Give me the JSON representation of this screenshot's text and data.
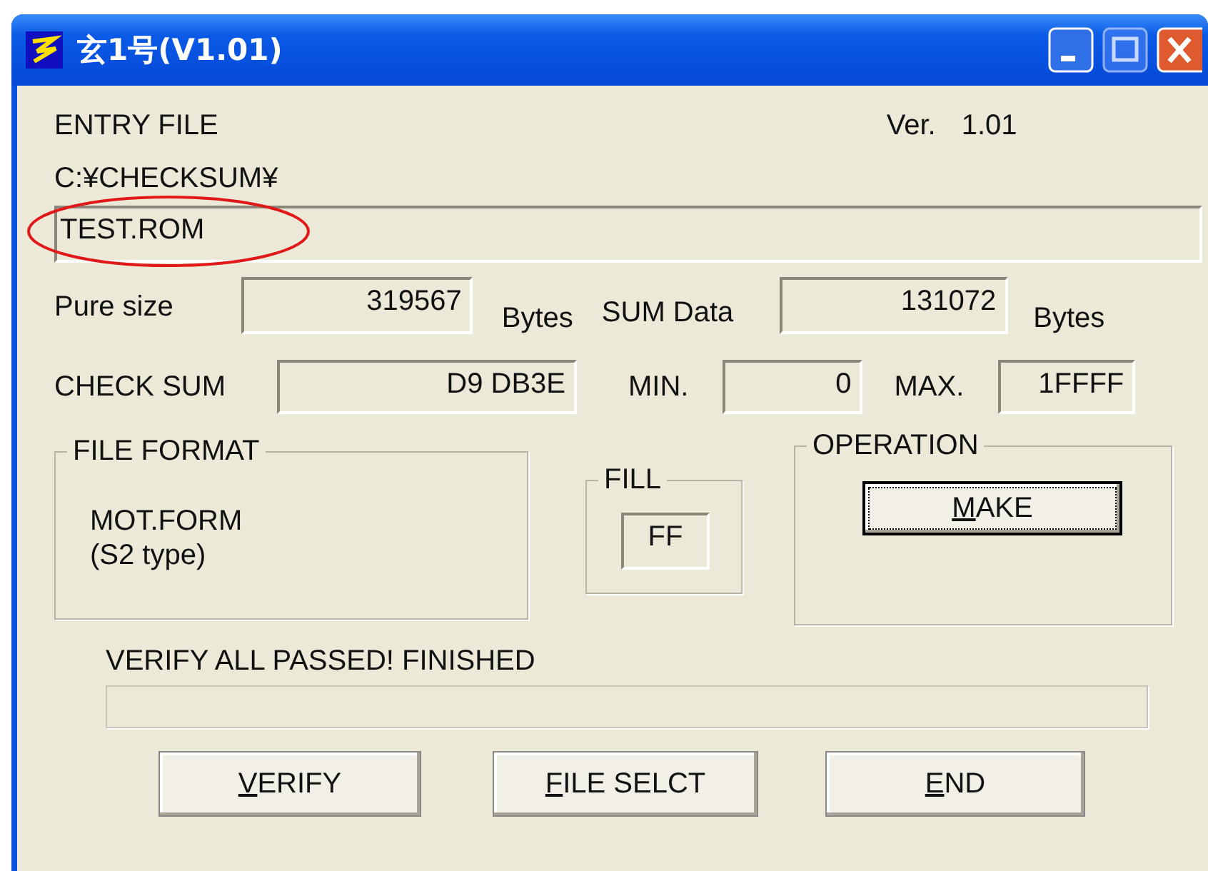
{
  "window": {
    "title": "玄1号(V1.01)"
  },
  "header": {
    "label": "ENTRY FILE",
    "version_label": "Ver.",
    "version": "1.01"
  },
  "path": "C:¥CHECKSUM¥",
  "file_name": {
    "value": "TEST.ROM",
    "highlighted": true
  },
  "size_fields": [
    {
      "label": "Pure size",
      "value": "319567",
      "unit": "Bytes"
    },
    {
      "label": "SUM Data",
      "value": "131072",
      "unit": "Bytes"
    }
  ],
  "checksum_fields": [
    {
      "label": "CHECK SUM",
      "value": "D9 DB3E"
    },
    {
      "label": "MIN.",
      "value": "0"
    },
    {
      "label": "MAX.",
      "value": "1FFFF"
    }
  ],
  "file_format": {
    "title": "FILE FORMAT",
    "lines": [
      "MOT.FORM",
      "(S2 type)"
    ]
  },
  "fill": {
    "title": "FILL",
    "value": "FF"
  },
  "operation": {
    "title": "OPERATION",
    "button": {
      "label": "MAKE",
      "focused": true
    }
  },
  "status": "VERIFY ALL PASSED! FINISHED",
  "buttons": [
    {
      "label": "VERIFY"
    },
    {
      "label": "FILE SELCT"
    },
    {
      "label": "END"
    }
  ]
}
